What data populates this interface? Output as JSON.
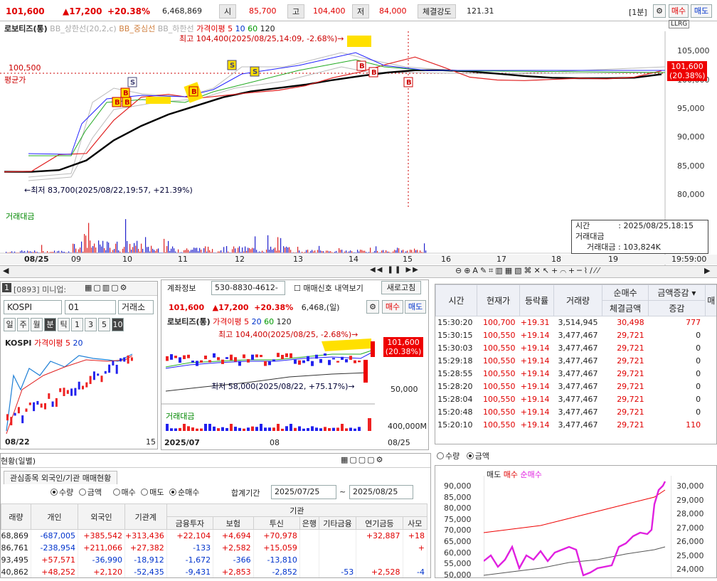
{
  "header": {
    "price": "101,600",
    "change": "▲17,200",
    "change_pct": "+20.38%",
    "volume": "6,468,869",
    "open_label": "시",
    "open": "85,700",
    "high_label": "고",
    "high": "104,400",
    "low_label": "저",
    "low": "84,000",
    "strength_label": "체결강도",
    "strength": "121.31",
    "period": "[1분]",
    "buy": "매수",
    "sell": "매도"
  },
  "main": {
    "stock": "로보티즈(통)",
    "legend_bb": "BB_상한선(20,2,c)",
    "legend_mid": "BB_중심선",
    "legend_low": "BB_하한선",
    "legend_ma": "가격이평 5",
    "ma10": "10",
    "ma60": "60",
    "ma120": "120",
    "max_annot": "최고 104,400(2025/08/25,14:09, -2.68%)→",
    "min_annot": "←최저 83,700(2025/08/22,19:57, +21.39%)",
    "avg_price": "100,500",
    "avg_label": "평균가",
    "last_price": "101,600",
    "last_pct": "(20.38%)",
    "volume_label": "거래대금",
    "tooltip": {
      "time_label": "시간",
      "time": ": 2025/08/25,18:15",
      "amount_label": "거래대금",
      "amount_row": "거래대금 : 103,824K"
    },
    "right_header": "LLRG",
    "dates": [
      "08/25",
      "09",
      "10",
      "11",
      "12",
      "13",
      "14",
      "15",
      "16",
      "17",
      "18",
      "19",
      "19:59:00"
    ]
  },
  "chart_data": {
    "type": "line",
    "title": "로보티즈(통)",
    "ylim": [
      79000,
      107000
    ],
    "yticks": [
      80000,
      85000,
      90000,
      95000,
      100000,
      105000
    ],
    "x_labels": [
      "08/25",
      "09",
      "10",
      "11",
      "12",
      "13",
      "14",
      "15",
      "16",
      "17",
      "18",
      "19"
    ],
    "series": [
      {
        "name": "가격이평 5",
        "values": [
          84000,
          84100,
          87000,
          87200,
          93000,
          97000,
          97500,
          96800,
          97300,
          97800,
          98200,
          99000,
          100400,
          101400,
          102800,
          104000,
          102300,
          100500,
          100000,
          99900,
          100100,
          100300,
          100200,
          100500,
          101600
        ]
      },
      {
        "name": "120",
        "values": [
          84000,
          84000,
          84300,
          86000,
          89500,
          92000,
          94000,
          95500,
          97000,
          98000,
          98600,
          99200,
          100000,
          100700,
          101300,
          101700,
          101700,
          101500,
          101100,
          100700,
          100400,
          100300,
          100300,
          100400,
          101000
        ]
      }
    ],
    "highlights": [
      {
        "label": "최고",
        "value": 104400
      },
      {
        "label": "최저",
        "value": 83700
      }
    ]
  },
  "mini": {
    "tab_num": "1",
    "code": "[0893] 미니업:",
    "index": "KOSPI",
    "index_code": "01",
    "market": "거래소",
    "periods": [
      "일",
      "주",
      "월",
      "분",
      "틱",
      "1",
      "3",
      "5",
      "10"
    ],
    "legend": "KOSPI",
    "ma_label": "가격이평 5",
    "ma20": "20",
    "xdate": "08/22",
    "xright": "15"
  },
  "center": {
    "tab": "계좌정보",
    "account": "530-8830-4612-",
    "signal": "매매신호 내역보기",
    "refresh": "새로고침",
    "price": "101,600",
    "change": "▲17,200",
    "pct": "+20.38%",
    "volume": "6,468,(일)",
    "buy": "매수",
    "sell": "매도",
    "stock": "로보티즈(통)",
    "ma_label": "가격이평 5",
    "ma20": "20",
    "ma60": "60",
    "ma120": "120",
    "max_annot": "최고 104,400(2025/08/25, -2.68%)→",
    "min_annot": "최저 58,000(2025/08/22, +75.17%)→",
    "last_price": "101,600",
    "last_pct": "(20.38%)",
    "tick50k": "50,000",
    "vol_label": "거래대금",
    "vol_tick": "400,000M",
    "x1": "2025/07",
    "x2": "08",
    "x3": "08/25"
  },
  "ticks": {
    "headers": [
      "시간",
      "현재가",
      "등락률",
      "거래량",
      "순매수",
      "금액증감",
      "매",
      "체결금액",
      "증감",
      "체"
    ],
    "rows": [
      [
        "15:30:20",
        "100,700",
        "+19.31",
        "3,514,945",
        "30,498",
        "777"
      ],
      [
        "15:30:15",
        "100,550",
        "+19.14",
        "3,477,467",
        "29,721",
        "0"
      ],
      [
        "15:30:03",
        "100,550",
        "+19.14",
        "3,477,467",
        "29,721",
        "0"
      ],
      [
        "15:29:18",
        "100,550",
        "+19.14",
        "3,477,467",
        "29,721",
        "0"
      ],
      [
        "15:28:55",
        "100,550",
        "+19.14",
        "3,477,467",
        "29,721",
        "0"
      ],
      [
        "15:28:20",
        "100,550",
        "+19.14",
        "3,477,467",
        "29,721",
        "0"
      ],
      [
        "15:28:04",
        "100,550",
        "+19.14",
        "3,477,467",
        "29,721",
        "0"
      ],
      [
        "15:20:48",
        "100,550",
        "+19.14",
        "3,477,467",
        "29,721",
        "0"
      ],
      [
        "15:20:10",
        "100,550",
        "+19.14",
        "3,477,467",
        "29,721",
        "110"
      ]
    ],
    "radio_qty": "수량",
    "radio_amt": "금액"
  },
  "flow": {
    "legend": [
      "매도",
      "매수",
      "순매수"
    ],
    "left_ticks": [
      "90,000",
      "85,000",
      "80,000",
      "75,000",
      "70,000",
      "65,000",
      "60,000",
      "55,000",
      "50,000"
    ],
    "right_ticks": [
      "30,000",
      "29,000",
      "28,000",
      "27,000",
      "26,000",
      "25,000",
      "24,000"
    ]
  },
  "bottom": {
    "title": "현황(일별)",
    "tab": "관심종목 외국인/기관 매매현황",
    "opts": [
      "수량",
      "금액",
      "매수",
      "매도",
      "순매수"
    ],
    "period_label": "합계기간",
    "date_from": "2025/07/25",
    "date_to": "2025/08/25",
    "headers": [
      "래량",
      "개인",
      "외국인",
      "기관계",
      "금융투자",
      "보험",
      "투신",
      "은행",
      "기타금융",
      "연기금등",
      "사모"
    ],
    "group": "기관",
    "rows": [
      [
        "68,869",
        "-687,005",
        "+385,542",
        "+313,436",
        "+22,104",
        "+4,694",
        "+70,978",
        "",
        "",
        "+32,887",
        "+18"
      ],
      [
        "86,761",
        "-238,954",
        "+211,066",
        "+27,382",
        "-133",
        "+2,582",
        "+15,059",
        "",
        "",
        "",
        "+"
      ],
      [
        "93,495",
        "+57,571",
        "-36,990",
        "-18,912",
        "-1,672",
        "-366",
        "-13,810",
        "",
        "",
        "",
        ""
      ],
      [
        "40,862",
        "+48,252",
        "+2,120",
        "-52,435",
        "-9,431",
        "+2,853",
        "-2,852",
        "",
        "-53",
        "+2,528",
        "-4"
      ]
    ]
  }
}
